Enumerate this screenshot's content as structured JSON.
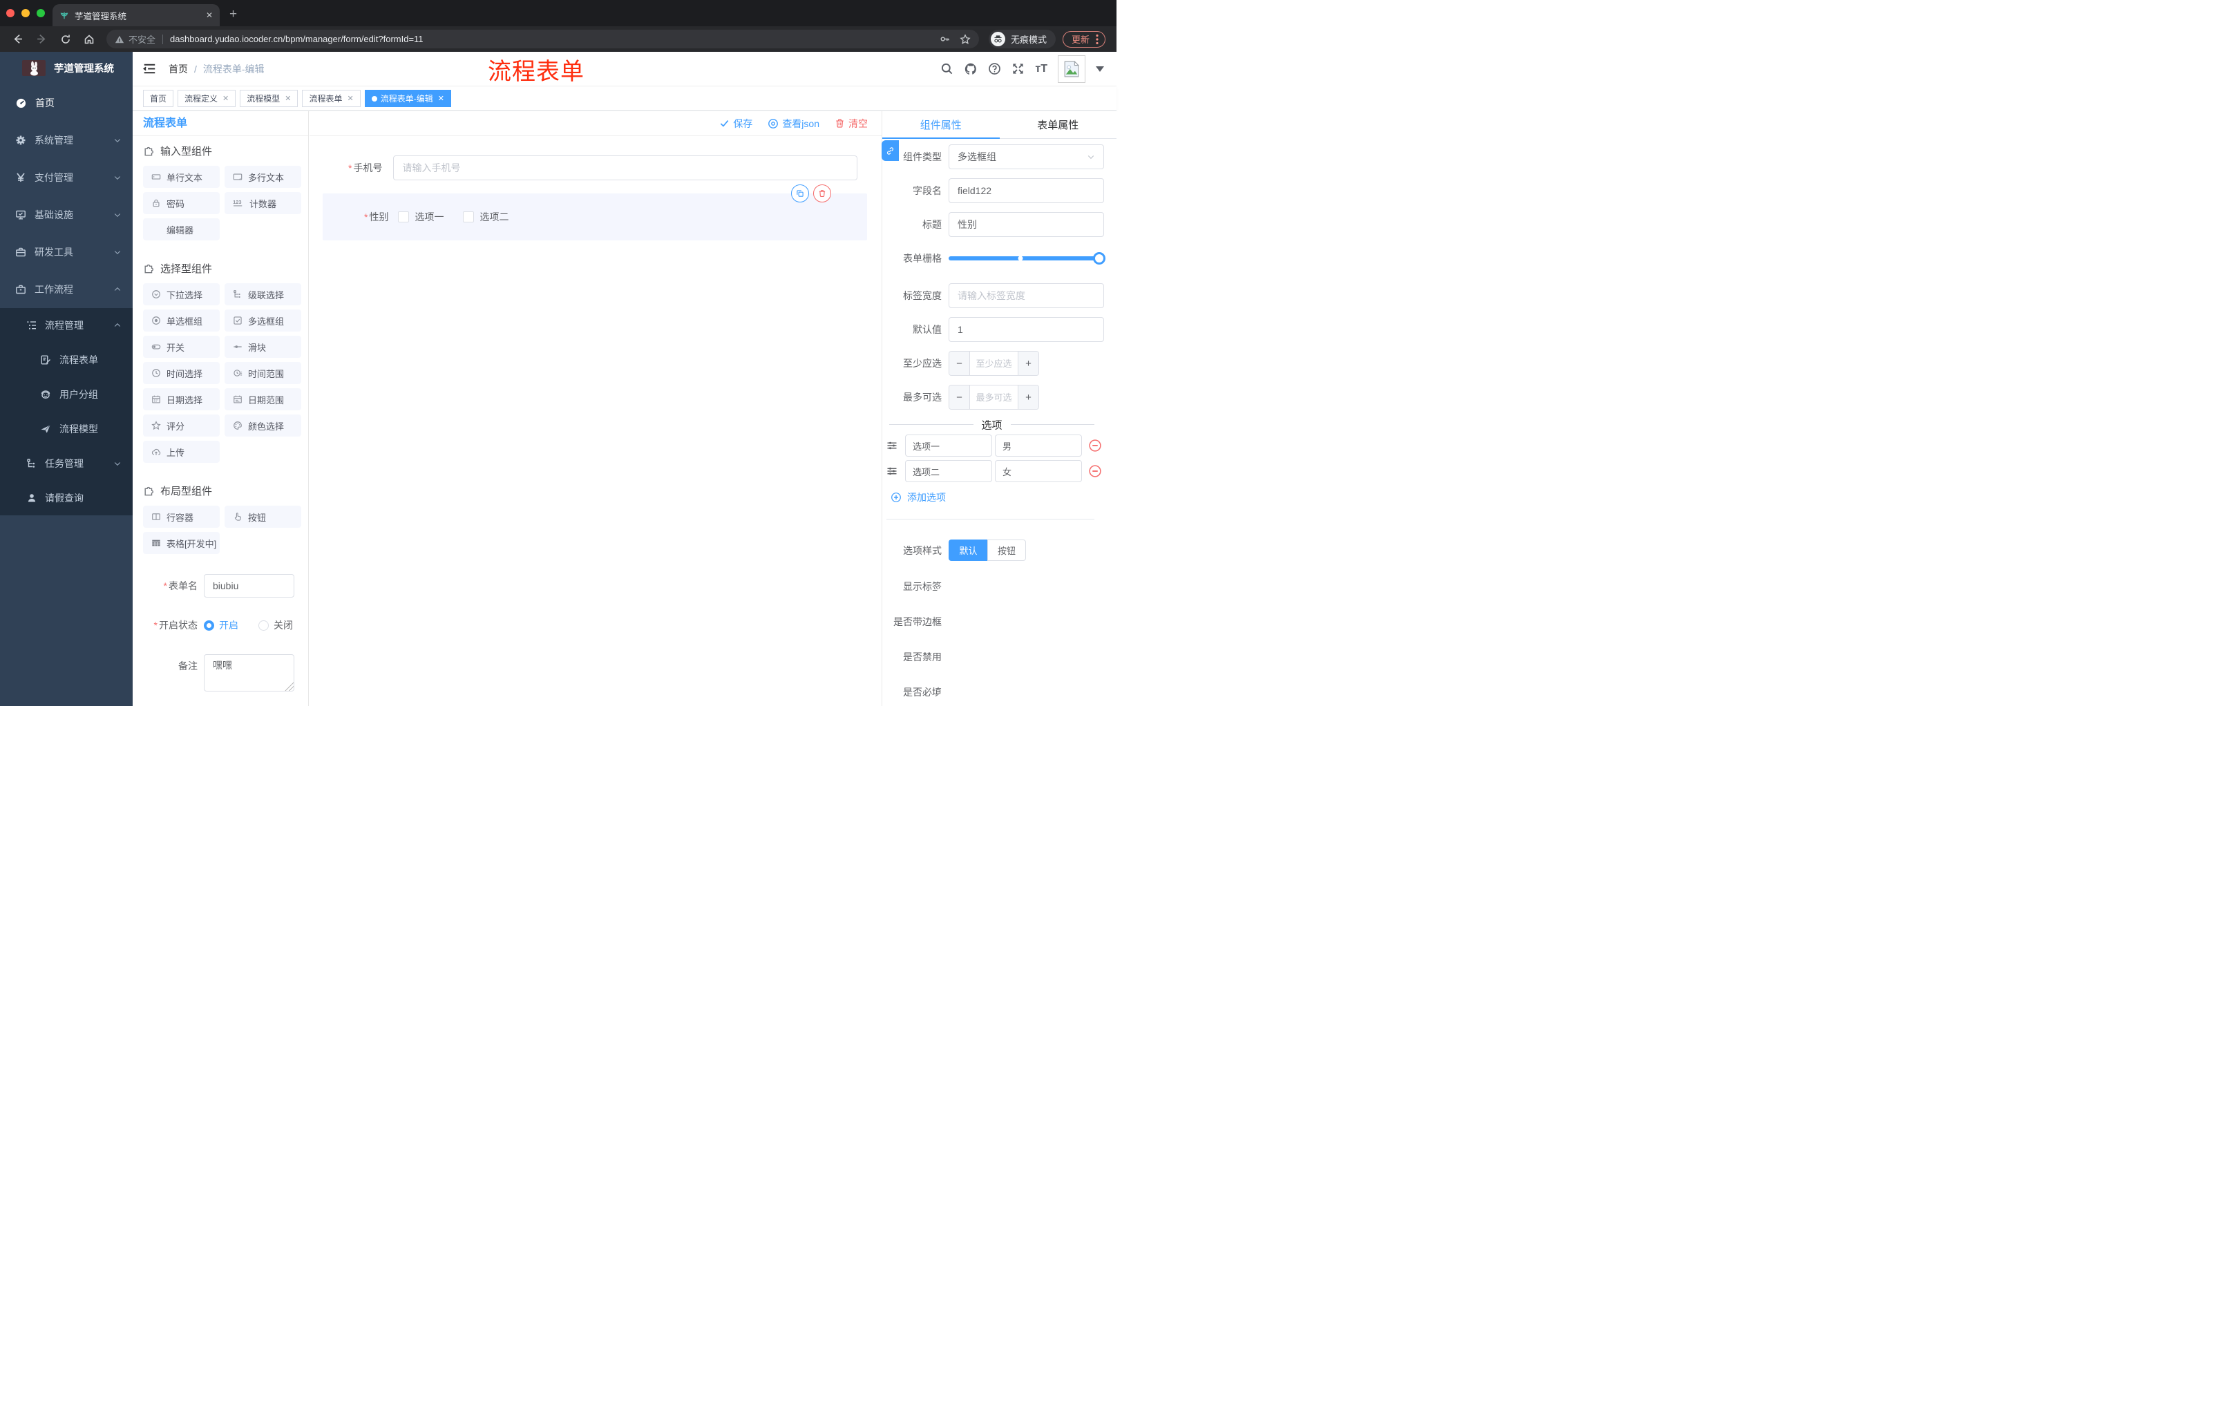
{
  "browser": {
    "tab_title": "芋道管理系统",
    "security_label": "不安全",
    "url_host": "dashboard.yudao.iocoder.cn",
    "url_path": "/bpm/manager/form/edit?formId=11",
    "incognito_label": "无痕模式",
    "update_label": "更新"
  },
  "colors": {
    "accent": "#409EFF",
    "danger": "#F56C6C",
    "sidebar_bg": "#304156",
    "submenu_bg": "#1F2D3D",
    "annotation_red": "#FE2D0E",
    "tag_active": "#409EFF"
  },
  "sidebar": {
    "logo_title": "芋道管理系统",
    "items": [
      {
        "label": "首页"
      },
      {
        "label": "系统管理"
      },
      {
        "label": "支付管理"
      },
      {
        "label": "基础设施"
      },
      {
        "label": "研发工具"
      },
      {
        "label": "工作流程"
      }
    ],
    "sub": {
      "parent": "流程管理",
      "leaves": [
        {
          "label": "流程表单"
        },
        {
          "label": "用户分组"
        },
        {
          "label": "流程模型"
        }
      ],
      "task": "任务管理",
      "leave": "请假查询"
    }
  },
  "header": {
    "breadcrumb_home": "首页",
    "breadcrumb_current": "流程表单-编辑",
    "annotation": "流程表单"
  },
  "tags": [
    {
      "label": "首页"
    },
    {
      "label": "流程定义"
    },
    {
      "label": "流程模型"
    },
    {
      "label": "流程表单"
    },
    {
      "label": "流程表单-编辑"
    }
  ],
  "palette": {
    "title": "流程表单",
    "sections": [
      {
        "title": "输入型组件",
        "items": [
          {
            "label": "单行文本"
          },
          {
            "label": "多行文本"
          },
          {
            "label": "密码"
          },
          {
            "label": "计数器"
          },
          {
            "label": "编辑器"
          }
        ]
      },
      {
        "title": "选择型组件",
        "items": [
          {
            "label": "下拉选择"
          },
          {
            "label": "级联选择"
          },
          {
            "label": "单选框组"
          },
          {
            "label": "多选框组"
          },
          {
            "label": "开关"
          },
          {
            "label": "滑块"
          },
          {
            "label": "时间选择"
          },
          {
            "label": "时间范围"
          },
          {
            "label": "日期选择"
          },
          {
            "label": "日期范围"
          },
          {
            "label": "评分"
          },
          {
            "label": "颜色选择"
          },
          {
            "label": "上传"
          }
        ]
      },
      {
        "title": "布局型组件",
        "items": [
          {
            "label": "行容器"
          },
          {
            "label": "按钮"
          },
          {
            "label": "表格[开发中]"
          }
        ]
      }
    ]
  },
  "meta": {
    "name_label": "表单名",
    "name_value": "biubiu",
    "status_label": "开启状态",
    "status_on": "开启",
    "status_off": "关闭",
    "remark_label": "备注",
    "remark_value": "嘿嘿"
  },
  "canvas": {
    "save": "保存",
    "view_json": "查看json",
    "clear": "清空",
    "phone_label": "手机号",
    "phone_placeholder": "请输入手机号",
    "gender_label": "性别",
    "gender_opt1": "选项一",
    "gender_opt2": "选项二"
  },
  "props": {
    "tab_component": "组件属性",
    "tab_form": "表单属性",
    "type_label": "组件类型",
    "type_value": "多选框组",
    "field_label": "字段名",
    "field_value": "field122",
    "title_label": "标题",
    "title_value": "性别",
    "grid_label": "表单栅格",
    "width_label": "标签宽度",
    "width_placeholder": "请输入标签宽度",
    "default_label": "默认值",
    "default_value": "1",
    "min_label": "至少应选",
    "min_placeholder": "至少应选",
    "max_label": "最多可选",
    "max_placeholder": "最多可选",
    "options_title": "选项",
    "options": [
      {
        "label": "选项一",
        "value": "男"
      },
      {
        "label": "选项二",
        "value": "女"
      }
    ],
    "add_option": "添加选项",
    "style_label": "选项样式",
    "style_default": "默认",
    "style_button": "按钮",
    "switch_show_label": "显示标签",
    "switch_border": "是否带边框",
    "switch_disabled": "是否禁用",
    "switch_required": "是否必填"
  }
}
